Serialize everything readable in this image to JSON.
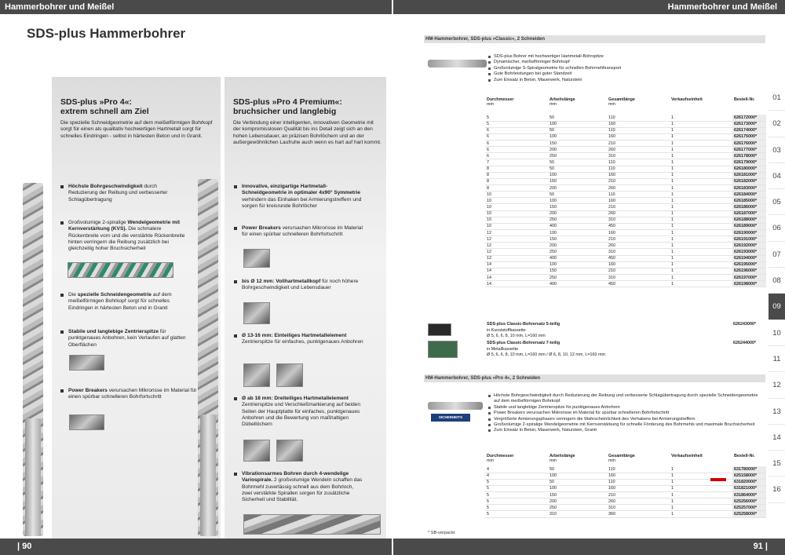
{
  "header": {
    "left": "Hammerbohrer und Meißel",
    "right": "Hammerbohrer und Meißel"
  },
  "footer": {
    "left": "| 90",
    "right": "91 |"
  },
  "page_title": "SDS-plus Hammerbohrer",
  "pro4": {
    "heading_line1": "SDS-plus »Pro 4«:",
    "heading_line2": "extrem schnell am Ziel",
    "intro": "Die spezielle Schneidgeometrie auf dem meißelförmigen Bohrkopf sorgt für einen als qualitativ hochwertigen Hartmetall sorgt für schnelles Eindringen - selbst in härtesten Beton und in Granit.",
    "b1_bold": "Höchste Bohrgeschwindigkeit",
    "b1_text": " durch Reduzierung der Reibung und verbesserter Schlagübertragung",
    "b2_pre": "Großvolumige 2-spiralige ",
    "b2_bold": "Wendelgeometrie mit Kernverstärkung (KVS).",
    "b2_text": " Die schmalere Rückenbreite vorn und die verstärkte Rückenbreite hinten verringern die Reibung zusätzlich bei gleichzeitig hoher Bruchsicherheit",
    "b3_pre": "Die ",
    "b3_bold": "spezielle Schneidengeometrie",
    "b3_text": " auf dem meißelförmigen Bohrkopf sorgt für schnelles Eindringen in härtesten Beton und in Granit",
    "b4_bold": "Stabile und langlebige Zentrierspitze",
    "b4_text": " für punktgenaues Anbohren, kein Verlaufen auf glatten Oberflächen",
    "b5_bold": "Power Breakers",
    "b5_text": " verursachen Mikrorisse im Material für einen spürbar schnelleren Bohrfortschritt"
  },
  "premium": {
    "heading_line1": "SDS-plus »Pro 4 Premium«:",
    "heading_line2": "bruchsicher und langlebig",
    "intro": "Die Verbindung einer intelligenten, innovativen Geometrie mit der kompromisslosen Qualität bis ins Detail zeigt sich an den hohen Lebensdauer, an präzisen Bohrlöchern und an der außergewöhnlichen Laufruhe auch wenn es hart auf hart kommt.",
    "b1_bold": "Innovative, einzigartige Hartmetall-Schneidgeometrie in optimaler 4x90° Symmetrie",
    "b1_text": " verhindern das Einhaken bei Armierungstreffern und sorgen für kreisrunde Bohrlöcher",
    "b2_bold": "Power Breakers",
    "b2_text": " verursachen Mikrorisse im Material für einen spürbar schnelleren Bohrfortschritt",
    "b3_bold": "bis Ø 12 mm: Vollhartmetallkopf",
    "b3_text": " für noch höhere Bohrgeschwindigkeit und Lebensdauer",
    "b4_bold": "Ø 13-16 mm: Einteiliges Hartmetallelement",
    "b4_text": " Zentrierspitze für einfaches, punktgenaues Anbohren",
    "b5_bold": "Ø ab 18 mm: Dreiteiliges Hartmetallelement",
    "b5_text": " Zentrierspitze und Verschleißmarkierung auf beiden Seiten der Hauptplatte für einfaches, punktgenaues Anbohren und die Bewertung von maßhaltigen Dübellöchern",
    "b6_bold": "Vibrationsarmes Bohren durch 4-wendelige Variospirale.",
    "b6_text": " 2 großvolumige Wendeln schaffen das Bohrmehl zuverlässig schnell aus dem Bohrloch, zwei verstärkte Spirallen sorgen für zusätzliche Sicherheit und Stabilität."
  },
  "classic": {
    "bar": "HM-Hammerbohrer, SDS-plus »Classic«, 2 Schneiden",
    "features": [
      "SDS-plus Bohrer mit hochwertiger Hartmetall-Bohrspitze",
      "Dynamischer, meißelförmiger Bohrkopf",
      "Großvolumige S-Spiralgeometrie für schnellen Bohrmehltransport",
      "Gute Bohrleistungen bei guter Standzeit",
      "Zum Einsatz in Beton, Mauerwerk, Naturstein"
    ],
    "headers": [
      "Durchmesser",
      "Arbeitslänge",
      "Gesamtlänge",
      "Verkaufseinheit",
      "Bestell-Nr."
    ],
    "units": [
      "mm",
      "mm",
      "mm",
      "",
      ""
    ],
    "rows": [
      [
        "5",
        "50",
        "110",
        "1",
        "626172000*"
      ],
      [
        "5",
        "100",
        "160",
        "1",
        "626173000*"
      ],
      [
        "6",
        "50",
        "110",
        "1",
        "626174000*"
      ],
      [
        "6",
        "100",
        "160",
        "1",
        "626175000*"
      ],
      [
        "6",
        "150",
        "210",
        "1",
        "626176000*"
      ],
      [
        "6",
        "200",
        "260",
        "1",
        "626177000*"
      ],
      [
        "6",
        "250",
        "310",
        "1",
        "626178000*"
      ],
      [
        "7",
        "50",
        "110",
        "1",
        "626179000*"
      ],
      [
        "8",
        "50",
        "110",
        "1",
        "626180000*"
      ],
      [
        "8",
        "100",
        "160",
        "1",
        "626181000*"
      ],
      [
        "8",
        "150",
        "210",
        "1",
        "626182000*"
      ],
      [
        "8",
        "200",
        "260",
        "1",
        "626183000*"
      ],
      [
        "10",
        "50",
        "110",
        "1",
        "626184000*"
      ],
      [
        "10",
        "100",
        "160",
        "1",
        "626185000*"
      ],
      [
        "10",
        "150",
        "210",
        "1",
        "626186000*"
      ],
      [
        "10",
        "200",
        "260",
        "1",
        "626187000*"
      ],
      [
        "10",
        "250",
        "310",
        "1",
        "626188000*"
      ],
      [
        "10",
        "400",
        "450",
        "1",
        "626189000*"
      ],
      [
        "12",
        "100",
        "160",
        "1",
        "626190000*"
      ],
      [
        "12",
        "150",
        "210",
        "1",
        "626191000*"
      ],
      [
        "12",
        "200",
        "260",
        "1",
        "626192000*"
      ],
      [
        "12",
        "250",
        "310",
        "1",
        "626193000*"
      ],
      [
        "12",
        "400",
        "450",
        "1",
        "626194000*"
      ],
      [
        "14",
        "100",
        "160",
        "1",
        "626195000*"
      ],
      [
        "14",
        "150",
        "210",
        "1",
        "626196000*"
      ],
      [
        "14",
        "250",
        "310",
        "1",
        "626197000*"
      ],
      [
        "14",
        "400",
        "450",
        "1",
        "626198000*"
      ]
    ],
    "set1_title": "SDS-plus Classic-Bohrersatz 5-teilig",
    "set1_l2": "in Kunststoffkassette",
    "set1_l3": "Ø 5, 6, 6, 8, 10 mm, L=160 mm",
    "set1_nr": "626243000*",
    "set2_title": "SDS-plus Classic-Bohrersatz 7-teilig",
    "set2_l2": "in Metallkassette",
    "set2_l3": "Ø 5, 6, 6, 8, 10 mm, L=160 mm / Ø 6, 8, 10, 12 mm, L=160 mm",
    "set2_nr": "626244000*"
  },
  "pro4table": {
    "bar": "HM-Hammerbohrer, SDS-plus »Pro 4«, 2 Schneiden",
    "features": [
      "Höchste Bohrgeschwindigkeit durch Reduzierung der Reibung und verbesserte Schlagübertragung durch spezielle Schneidengeometrie auf dem meißelförmigen Bohrkopf",
      "Stabile und langlebige Zentrierspitze für punktgenaues Anbohren",
      "Power Breakers verursachen Mikrorisse im Material für spürbar schnelleren Bohrfortschritt",
      "Vergrößerte Armierungsphasen verringern die Wahrscheinlichkeit des Verhakens bei Armierungstreffern",
      "Großvolumige 2-spiralige Wendelgeometrie mit Kernverstärkung für schnelle Förderung des Bohrmehls und maximale Bruchsicherheit",
      "Zum Einsatz in Beton, Mauerwerk, Naturstein, Granit"
    ],
    "badge": "SICHERHEITS",
    "rows": [
      [
        "4",
        "50",
        "110",
        "1",
        "631780000*"
      ],
      [
        "4",
        "100",
        "160",
        "1",
        "625158000*"
      ],
      [
        "5",
        "50",
        "110",
        "1",
        "631820000*"
      ],
      [
        "5",
        "100",
        "160",
        "1",
        "631821000*"
      ],
      [
        "5",
        "150",
        "210",
        "1",
        "631864000*"
      ],
      [
        "5",
        "200",
        "260",
        "1",
        "625256000*"
      ],
      [
        "5",
        "250",
        "310",
        "1",
        "625257000*"
      ],
      [
        "5",
        "310",
        "360",
        "1",
        "625258000*"
      ]
    ]
  },
  "note": "* SB-verpackt",
  "tabs": [
    "01",
    "02",
    "03",
    "04",
    "05",
    "06",
    "07",
    "08",
    "09",
    "10",
    "11",
    "12",
    "13",
    "14",
    "15",
    "16"
  ]
}
